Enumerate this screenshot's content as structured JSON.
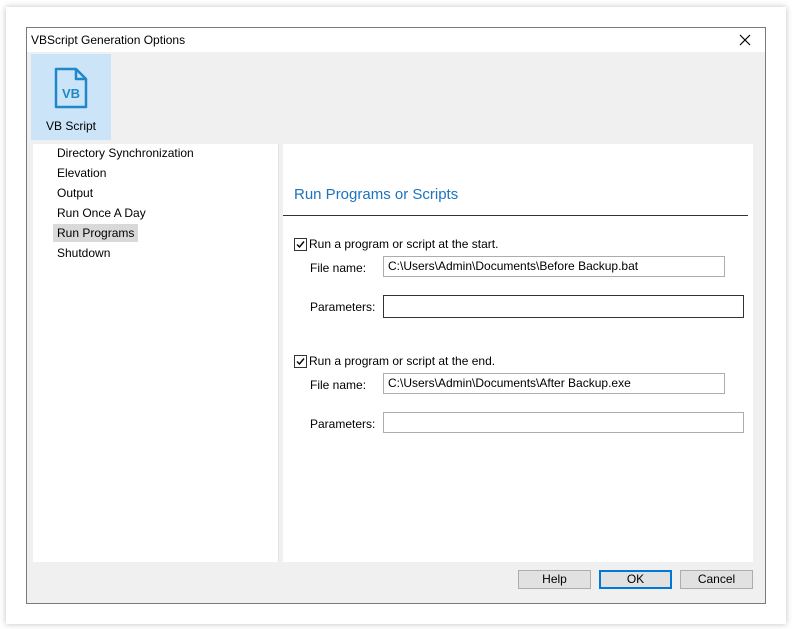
{
  "window": {
    "title": "VBScript Generation Options",
    "close_icon": "close-icon"
  },
  "ribbon": {
    "items": [
      {
        "label": "VB Script",
        "icon": "vb-script-file-icon",
        "icon_text": "VB",
        "accent": "#1e88c8"
      }
    ]
  },
  "nav": {
    "items": [
      {
        "label": "Directory Synchronization"
      },
      {
        "label": "Elevation"
      },
      {
        "label": "Output"
      },
      {
        "label": "Run Once A Day"
      },
      {
        "label": "Run Programs",
        "selected": true
      },
      {
        "label": "Shutdown"
      }
    ]
  },
  "panel": {
    "heading": "Run Programs or Scripts",
    "heading_color": "#1e73be",
    "start": {
      "checkbox_label": "Run a program or script at the start.",
      "checked": true,
      "file_label": "File name:",
      "file_value": "C:\\Users\\Admin\\Documents\\Before Backup.bat",
      "params_label": "Parameters:",
      "params_value": ""
    },
    "end": {
      "checkbox_label": "Run a program or script at the end.",
      "checked": true,
      "file_label": "File name:",
      "file_value": "C:\\Users\\Admin\\Documents\\After Backup.exe",
      "params_label": "Parameters:",
      "params_value": ""
    }
  },
  "buttons": {
    "help": "Help",
    "ok": "OK",
    "cancel": "Cancel"
  }
}
